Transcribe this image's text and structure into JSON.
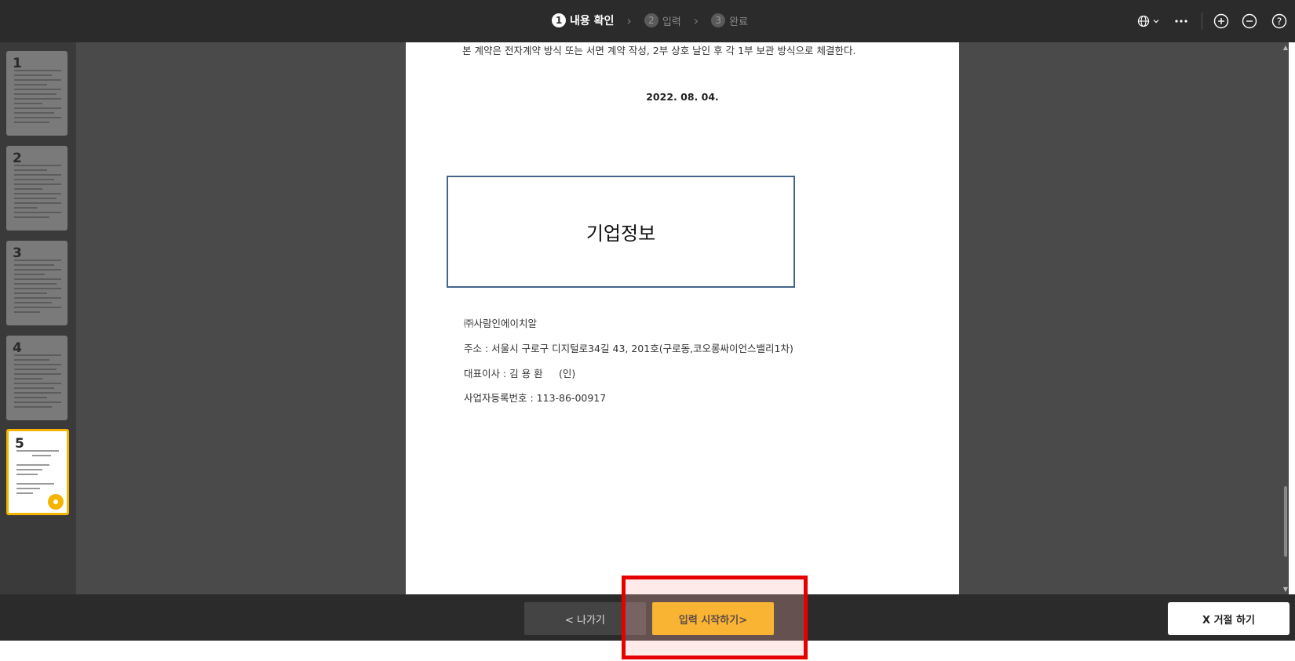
{
  "steps": [
    {
      "num": "1",
      "label": "내용 확인"
    },
    {
      "num": "2",
      "label": "입력"
    },
    {
      "num": "3",
      "label": "완료"
    }
  ],
  "toolbar": {
    "icons": [
      "globe-icon",
      "chevron-down-icon",
      "more-icon",
      "zoom-in-icon",
      "zoom-out-icon",
      "help-icon"
    ]
  },
  "thumbnails": [
    {
      "num": "1"
    },
    {
      "num": "2"
    },
    {
      "num": "3"
    },
    {
      "num": "4"
    },
    {
      "num": "5",
      "selected": true
    }
  ],
  "document": {
    "top_line": "본 계약은 전자계약 방식 또는 서면 계약 작성, 2부 상호 날인 후 각 1부 보관 방식으로 체결한다.",
    "date": "2022. 08. 04.",
    "company_box_label": "기업정보",
    "company_name": "㈜사람인에이치알",
    "address": "주소 : 서울시 구로구 디지털로34길 43, 201호(구로동,코오롱싸이언스밸리1차)",
    "ceo": "대표이사 : 김 용 환 　 (인)",
    "business_number": "사업자등록번호 : 113-86-00917"
  },
  "buttons": {
    "exit": "< 나가기",
    "start": "입력 시작하기>",
    "reject": "X 거절 하기"
  },
  "colors": {
    "accent": "#f5b400",
    "highlight": "#e60000",
    "topbar": "#2b2b2b"
  }
}
